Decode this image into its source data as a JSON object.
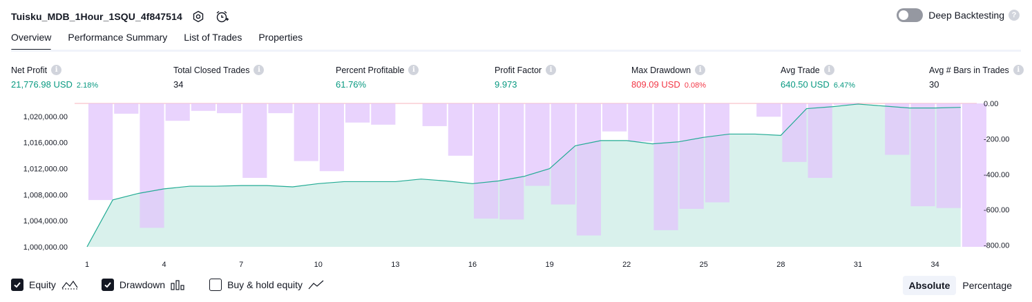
{
  "header": {
    "title": "Tuisku_MDB_1Hour_1SQU_4f847514",
    "deep_backtesting_label": "Deep Backtesting",
    "help_glyph": "?"
  },
  "tabs": [
    {
      "label": "Overview",
      "active": true
    },
    {
      "label": "Performance Summary",
      "active": false
    },
    {
      "label": "List of Trades",
      "active": false
    },
    {
      "label": "Properties",
      "active": false
    }
  ],
  "metrics": {
    "info_glyph": "i",
    "net_profit": {
      "label": "Net Profit",
      "value": "21,776.98 USD",
      "pct": "2.18%"
    },
    "total_closed_trades": {
      "label": "Total Closed Trades",
      "value": "34"
    },
    "percent_profitable": {
      "label": "Percent Profitable",
      "value": "61.76%"
    },
    "profit_factor": {
      "label": "Profit Factor",
      "value": "9.973"
    },
    "max_drawdown": {
      "label": "Max Drawdown",
      "value": "809.09 USD",
      "pct": "0.08%"
    },
    "avg_trade": {
      "label": "Avg Trade",
      "value": "640.50 USD",
      "pct": "6.47%"
    },
    "avg_bars": {
      "label": "Avg # Bars in Trades",
      "value": "30"
    }
  },
  "legend": {
    "equity": {
      "label": "Equity",
      "checked": true
    },
    "drawdown": {
      "label": "Drawdown",
      "checked": true
    },
    "buy_hold": {
      "label": "Buy & hold equity",
      "checked": false
    }
  },
  "toggle_buttons": {
    "absolute": "Absolute",
    "percentage": "Percentage",
    "active": "absolute"
  },
  "colors": {
    "equity_line": "#22ab94",
    "equity_fill": "#d5f0ea",
    "drawdown_bar": "#e1c4fc",
    "positive": "#089981",
    "negative": "#f23645"
  },
  "chart_data": {
    "type": "bar+area",
    "x_ticks": [
      "1",
      "4",
      "7",
      "10",
      "13",
      "16",
      "19",
      "22",
      "25",
      "28",
      "31",
      "34"
    ],
    "left_axis": {
      "label": "",
      "ticks": [
        "1,000,000.00",
        "1,004,000.00",
        "1,008,000.00",
        "1,012,000.00",
        "1,016,000.00",
        "1,020,000.00"
      ],
      "range": [
        1000000,
        1022000
      ]
    },
    "right_axis": {
      "label": "",
      "ticks": [
        "0.00",
        "-200.00",
        "-400.00",
        "-600.00",
        "-800.00"
      ],
      "range": [
        -809.09,
        0
      ]
    },
    "series": [
      {
        "name": "Equity",
        "type": "area",
        "x": [
          0,
          1,
          2,
          3,
          4,
          5,
          6,
          7,
          8,
          9,
          10,
          11,
          12,
          13,
          14,
          15,
          16,
          17,
          18,
          19,
          20,
          21,
          22,
          23,
          24,
          25,
          26,
          27,
          28,
          29,
          30,
          31,
          32,
          33,
          34
        ],
        "values": [
          1000000,
          1007200,
          1008200,
          1008900,
          1009300,
          1009300,
          1009400,
          1009400,
          1009200,
          1009700,
          1010000,
          1010000,
          1010000,
          1010400,
          1010100,
          1009700,
          1010100,
          1010800,
          1012000,
          1015500,
          1016300,
          1016300,
          1015800,
          1016100,
          1016800,
          1017300,
          1017300,
          1017100,
          1021200,
          1021500,
          1021900,
          1021600,
          1021300,
          1021300,
          1021400
        ]
      },
      {
        "name": "Drawdown",
        "type": "bar",
        "x": [
          1,
          2,
          3,
          4,
          5,
          6,
          7,
          8,
          9,
          10,
          11,
          12,
          13,
          14,
          15,
          16,
          17,
          18,
          19,
          20,
          21,
          22,
          23,
          24,
          25,
          26,
          27,
          28,
          29,
          30,
          31,
          32,
          33,
          34,
          35
        ],
        "values": [
          -545,
          -58,
          -702,
          -98,
          -42,
          -55,
          -420,
          -55,
          -325,
          -382,
          -108,
          -120,
          0,
          -128,
          -295,
          -650,
          -655,
          -465,
          -570,
          -745,
          -158,
          -215,
          -715,
          -595,
          -558,
          0,
          -75,
          -330,
          -420,
          -8,
          0,
          -290,
          -580,
          -590,
          -809.09
        ]
      }
    ]
  }
}
